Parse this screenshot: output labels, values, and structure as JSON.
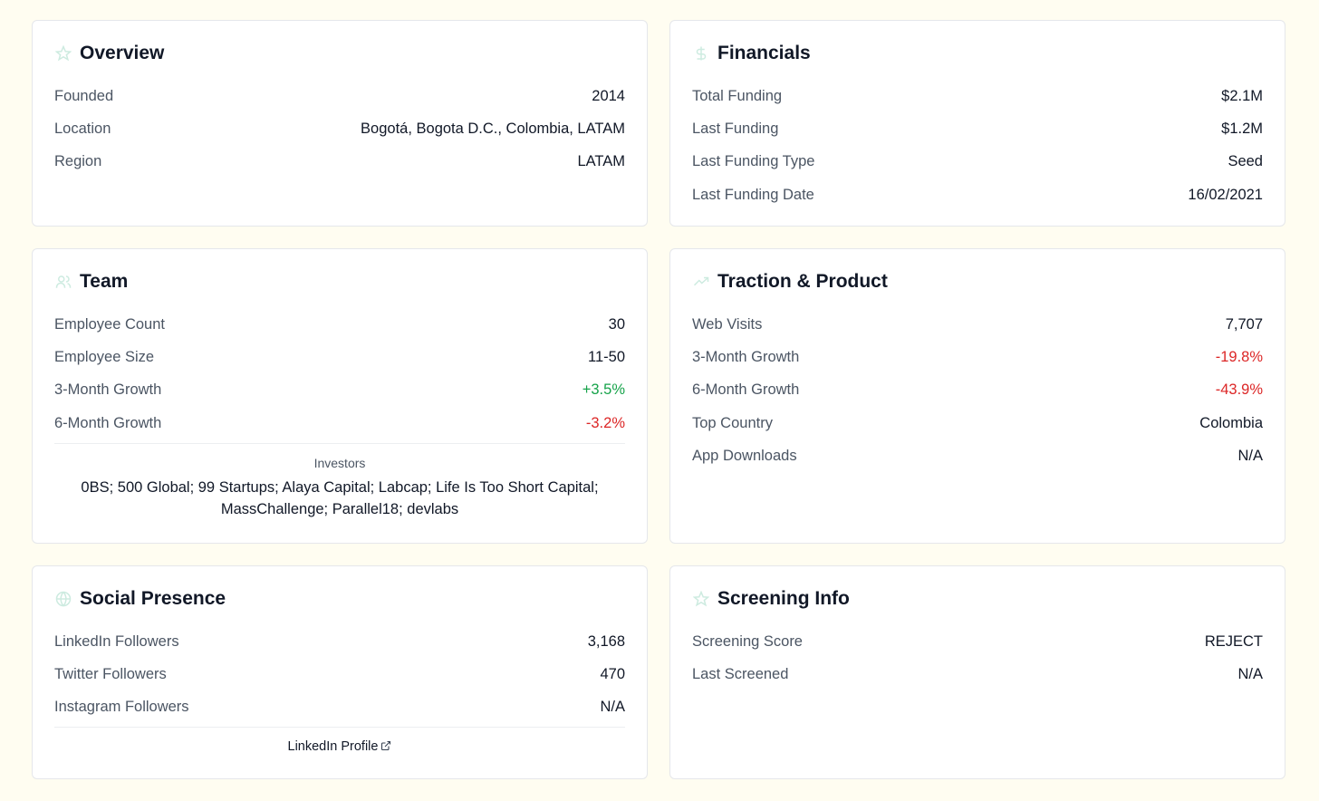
{
  "overview": {
    "title": "Overview",
    "icon": "star-icon",
    "rows": [
      {
        "label": "Founded",
        "value": "2014"
      },
      {
        "label": "Location",
        "value": "Bogotá, Bogota D.C., Colombia, LATAM"
      },
      {
        "label": "Region",
        "value": "LATAM"
      }
    ]
  },
  "financials": {
    "title": "Financials",
    "icon": "dollar-icon",
    "rows": [
      {
        "label": "Total Funding",
        "value": "$2.1M"
      },
      {
        "label": "Last Funding",
        "value": "$1.2M"
      },
      {
        "label": "Last Funding Type",
        "value": "Seed"
      },
      {
        "label": "Last Funding Date",
        "value": "16/02/2021"
      }
    ]
  },
  "team": {
    "title": "Team",
    "icon": "users-icon",
    "rows": [
      {
        "label": "Employee Count",
        "value": "30"
      },
      {
        "label": "Employee Size",
        "value": "11-50"
      },
      {
        "label": "3-Month Growth",
        "value": "+3.5%"
      },
      {
        "label": "6-Month Growth",
        "value": "-3.2%"
      }
    ],
    "investors_label": "Investors",
    "investors": "0BS; 500 Global; 99 Startups; Alaya Capital; Labcap; Life Is Too Short Capital; MassChallenge; Parallel18; devlabs"
  },
  "traction": {
    "title": "Traction & Product",
    "icon": "trending-icon",
    "rows": [
      {
        "label": "Web Visits",
        "value": "7,707"
      },
      {
        "label": "3-Month Growth",
        "value": "-19.8%"
      },
      {
        "label": "6-Month Growth",
        "value": "-43.9%"
      },
      {
        "label": "Top Country",
        "value": "Colombia"
      },
      {
        "label": "App Downloads",
        "value": "N/A"
      }
    ]
  },
  "social": {
    "title": "Social Presence",
    "icon": "globe-icon",
    "rows": [
      {
        "label": "LinkedIn Followers",
        "value": "3,168"
      },
      {
        "label": "Twitter Followers",
        "value": "470"
      },
      {
        "label": "Instagram Followers",
        "value": "N/A"
      }
    ],
    "profile_link": "LinkedIn Profile"
  },
  "screening": {
    "title": "Screening Info",
    "icon": "star-icon",
    "rows": [
      {
        "label": "Screening Score",
        "value": "REJECT"
      },
      {
        "label": "Last Screened",
        "value": "N/A"
      }
    ]
  },
  "colors": {
    "accent_icon": "#cdebe0",
    "negative": "#dc2626",
    "positive": "#16a34a"
  }
}
